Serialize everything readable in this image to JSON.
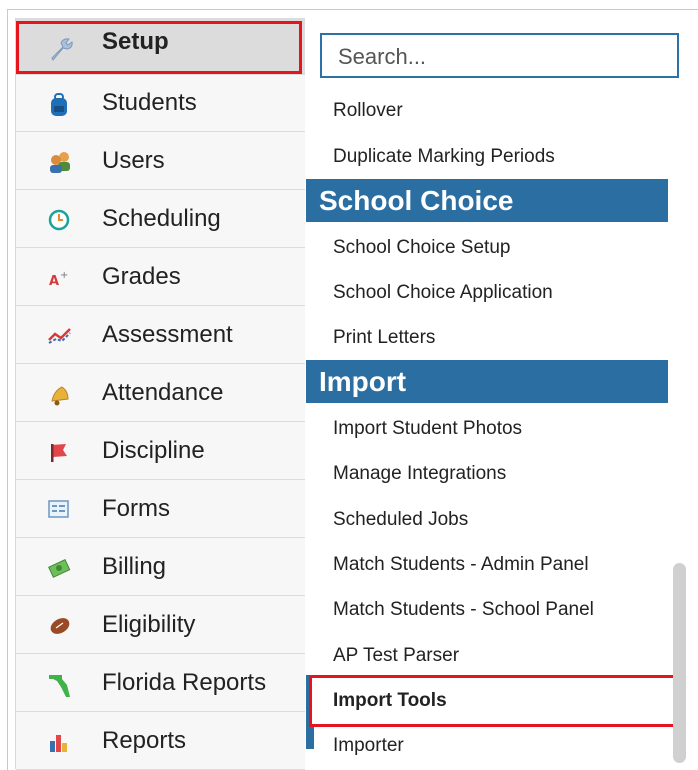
{
  "sidebar": {
    "items": [
      {
        "label": "Setup",
        "icon": "wrench-icon",
        "active": true
      },
      {
        "label": "Students",
        "icon": "backpack-icon"
      },
      {
        "label": "Users",
        "icon": "users-icon"
      },
      {
        "label": "Scheduling",
        "icon": "clock-icon"
      },
      {
        "label": "Grades",
        "icon": "grade-a-plus-icon"
      },
      {
        "label": "Assessment",
        "icon": "line-chart-icon"
      },
      {
        "label": "Attendance",
        "icon": "bell-icon"
      },
      {
        "label": "Discipline",
        "icon": "flag-icon"
      },
      {
        "label": "Forms",
        "icon": "form-icon"
      },
      {
        "label": "Billing",
        "icon": "money-icon"
      },
      {
        "label": "Eligibility",
        "icon": "football-icon"
      },
      {
        "label": "Florida Reports",
        "icon": "florida-map-icon"
      },
      {
        "label": "Reports",
        "icon": "bar-chart-icon"
      }
    ]
  },
  "search": {
    "placeholder": "Search..."
  },
  "menu": {
    "rollover": "Rollover",
    "duplicate": "Duplicate Marking Periods",
    "school_choice_header": "School Choice",
    "school_choice_setup": "School Choice Setup",
    "school_choice_application": "School Choice Application",
    "print_letters": "Print Letters",
    "import_header": "Import",
    "import_student_photos": "Import Student Photos",
    "manage_integrations": "Manage Integrations",
    "scheduled_jobs": "Scheduled Jobs",
    "match_admin": "Match Students - Admin Panel",
    "match_school": "Match Students - School Panel",
    "ap_test_parser": "AP Test Parser",
    "import_tools": "Import Tools",
    "importer": "Importer"
  },
  "colors": {
    "accent": "#2b6ea1",
    "highlight": "#e6141c"
  }
}
